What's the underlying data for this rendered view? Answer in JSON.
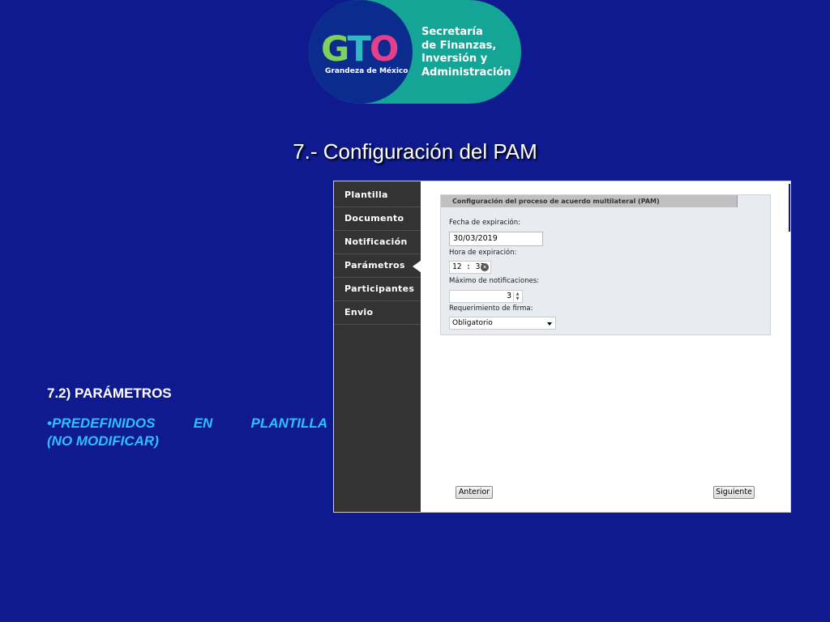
{
  "logo": {
    "gto_g": "G",
    "gto_t": "T",
    "gto_o": "O",
    "tagline": "Grandeza de México",
    "org_lines": [
      "Secretaría",
      "de Finanzas,",
      "Inversión y",
      "Administración"
    ]
  },
  "slide": {
    "title": "7.- Configuración del PAM",
    "section_heading": "7.2) PARÁMETROS",
    "bullet_line1": "•PREDEFINIDOS EN PLANTILLA",
    "bullet_line2": "(NO MODIFICAR)"
  },
  "sidebar": {
    "items": [
      {
        "label": "Plantilla"
      },
      {
        "label": "Documento"
      },
      {
        "label": "Notificación"
      },
      {
        "label": "Parámetros",
        "active": true
      },
      {
        "label": "Participantes"
      },
      {
        "label": "Envio"
      }
    ]
  },
  "panel": {
    "header": "Configuración del proceso de acuerdo multilateral (PAM)",
    "expiry_date_label": "Fecha de expiración:",
    "expiry_date_value": "30/03/2019",
    "expiry_time_label": "Hora de expiración:",
    "expiry_time_value": "12 : 31",
    "max_notifications_label": "Máximo de notificaciones:",
    "max_notifications_value": "3",
    "signature_label": "Requerimiento de firma:",
    "signature_value": "Obligatorio"
  },
  "buttons": {
    "previous": "Anterior",
    "next": "Siguiente"
  },
  "colors": {
    "background": "#0e1a8e",
    "sidebar": "#333333",
    "logo_teal": "#15a596",
    "bullet_text": "#2bc0ff"
  }
}
